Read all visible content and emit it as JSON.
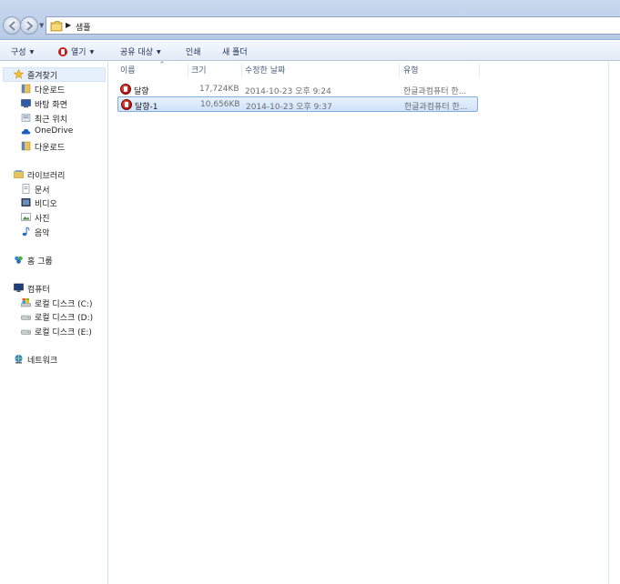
{
  "address_bar": {
    "path": [
      "샘플"
    ]
  },
  "toolbar": {
    "organize": "구성",
    "open": "열기",
    "share_with": "공유 대상",
    "print": "인쇄",
    "new_folder": "새 폴더"
  },
  "nav": {
    "favorites": "즐겨찾기",
    "downloads_1": "다운로드",
    "desktop": "바탕 화면",
    "recent": "최근 위치",
    "onedrive": "OneDrive",
    "downloads_2": "다운로드",
    "libraries": "라이브러리",
    "documents": "문서",
    "videos": "비디오",
    "pictures": "사진",
    "music": "음악",
    "homegroup": "홈 그룹",
    "computer": "컴퓨터",
    "disk_c": "로컬 디스크 (C:)",
    "disk_d": "로컬 디스크 (D:)",
    "disk_e": "로컬 디스크 (E:)",
    "network": "네트워크"
  },
  "columns": {
    "name": "이름",
    "size": "크기",
    "modified": "수정한 날짜",
    "type": "유형"
  },
  "files": [
    {
      "name": "달향",
      "size": "17,724KB",
      "modified": "2014-10-23 오후 9:24",
      "type": "한글과컴퓨터 한...",
      "icon": "hwp-document-icon",
      "selected": false
    },
    {
      "name": "달향-1",
      "size": "10,656KB",
      "modified": "2014-10-23 오후 9:37",
      "type": "한글과컴퓨터 한...",
      "icon": "hwp-document-icon",
      "selected": true
    }
  ],
  "colors": {
    "selection_bg": "#cfe3fb",
    "selection_border": "#84acdd",
    "toolbar_text": "#1e3359"
  }
}
